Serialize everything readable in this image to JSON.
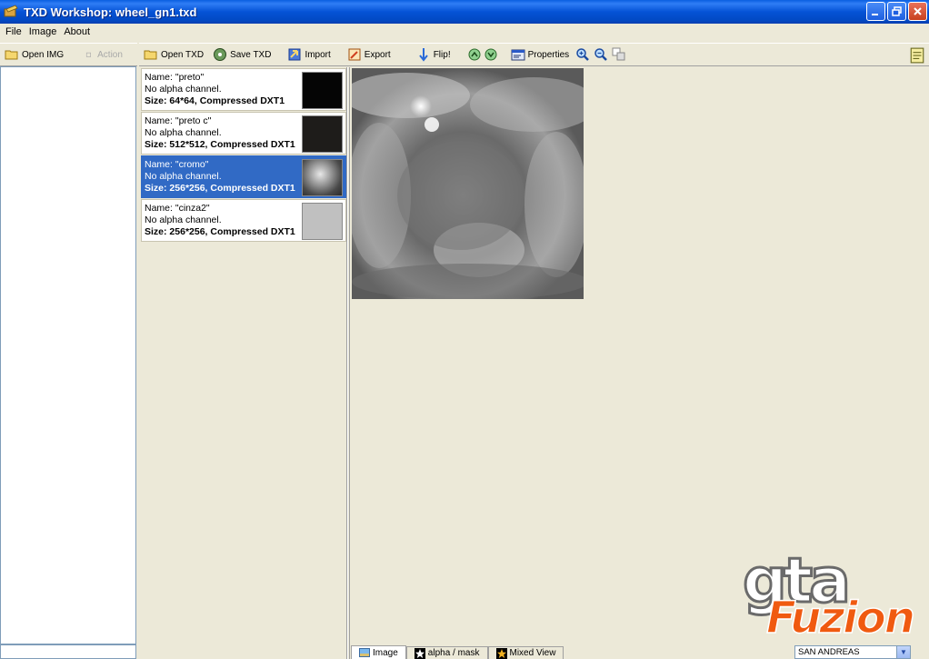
{
  "window": {
    "title": "TXD Workshop: wheel_gn1.txd"
  },
  "menu": [
    "File",
    "Image",
    "About"
  ],
  "left_toolbar": {
    "open_img": "Open IMG",
    "action": "Action"
  },
  "main_toolbar": {
    "open_txd": "Open TXD",
    "save_txd": "Save TXD",
    "import": "Import",
    "export": "Export",
    "flip": "Flip!",
    "properties": "Properties"
  },
  "textures": [
    {
      "name": "Name: \"preto\"",
      "alpha": "No alpha channel.",
      "size": "Size: 64*64, Compressed DXT1",
      "thumb_color": "#050505",
      "selected": false
    },
    {
      "name": "Name: \"preto c\"",
      "alpha": "No alpha channel.",
      "size": "Size: 512*512, Compressed DXT1",
      "thumb_color": "#1e1c1a",
      "selected": false
    },
    {
      "name": "Name: \"cromo\"",
      "alpha": "No alpha channel.",
      "size": "Size: 256*256, Compressed DXT1",
      "thumb_color": "#7a7a7a",
      "selected": true
    },
    {
      "name": "Name: \"cinza2\"",
      "alpha": "No alpha channel.",
      "size": "Size: 256*256, Compressed DXT1",
      "thumb_color": "#c0c0c0",
      "selected": false
    }
  ],
  "tabs": {
    "image": "Image",
    "alpha": "alpha / mask",
    "mixed": "Mixed View"
  },
  "game_select": {
    "value": "SAN ANDREAS"
  },
  "logo": {
    "top": "gta",
    "bottom": "Fuzion"
  },
  "colors": {
    "selection": "#316ac5",
    "titlebar": "#0553d6"
  }
}
